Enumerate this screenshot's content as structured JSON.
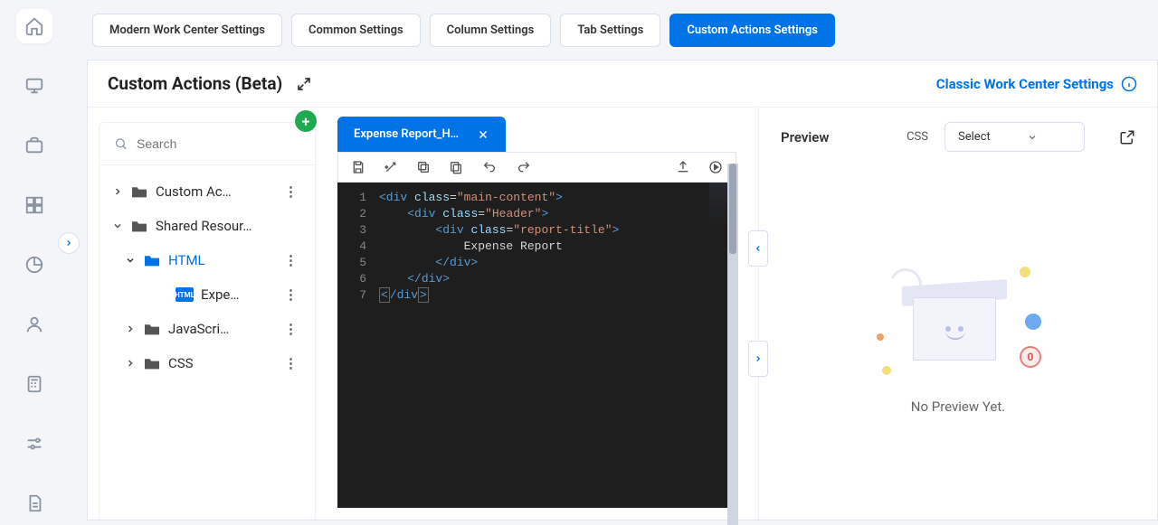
{
  "tabs": [
    {
      "label": "Modern Work Center Settings"
    },
    {
      "label": "Common Settings"
    },
    {
      "label": "Column Settings"
    },
    {
      "label": "Tab Settings"
    },
    {
      "label": "Custom Actions Settings"
    }
  ],
  "page_title": "Custom Actions (Beta)",
  "classic_link": "Classic Work Center Settings",
  "search": {
    "placeholder": "Search"
  },
  "tree": {
    "custom_actions": "Custom Ac…",
    "shared": "Shared Resour…",
    "html": "HTML",
    "file_html": "Expe…",
    "js": "JavaScri…",
    "css": "CSS"
  },
  "editor_tab": "Expense Report_H…",
  "code_lines": [
    "1",
    "2",
    "3",
    "4",
    "5",
    "6",
    "7"
  ],
  "code_tokens": {
    "l1": {
      "open": "<div",
      "attr": "class",
      "val": "\"main-content\"",
      "close": ">"
    },
    "l2": {
      "open": "<div",
      "attr": "class",
      "val": "\"Header\"",
      "close": ">"
    },
    "l3": {
      "open": "<div",
      "attr": "class",
      "val": "\"report-title\"",
      "close": ">"
    },
    "l4": {
      "text": "Expense Report"
    },
    "l5": {
      "close": "</div>"
    },
    "l6": {
      "close": "</div>"
    },
    "l7a": "<",
    "l7b": "/div",
    "l7c": ">"
  },
  "preview": {
    "title": "Preview",
    "css_label": "CSS",
    "select_placeholder": "Select",
    "empty_text": "No Preview Yet.",
    "badge": "0"
  }
}
